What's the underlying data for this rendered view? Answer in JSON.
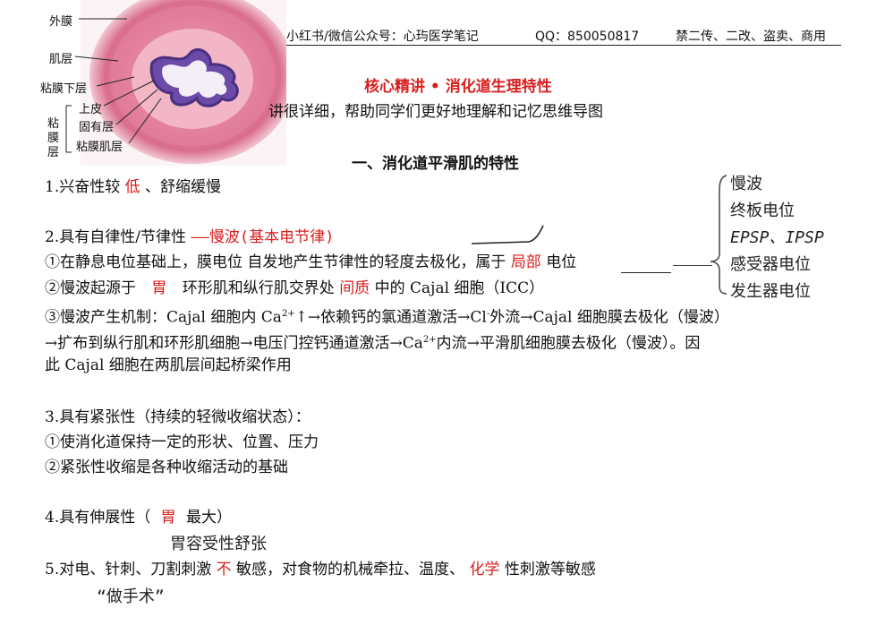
{
  "figure": {
    "labels": {
      "serosa": "外膜",
      "muscularis": "肌层",
      "submucosa": "粘膜下层",
      "epithelium": "上皮",
      "lamina_propria": "固有层",
      "muscularis_mucosae": "粘膜肌层",
      "mucosa_chars": [
        "粘",
        "膜",
        "层"
      ]
    }
  },
  "header": {
    "source": "小红书/微信公众号：心玙医学笔记",
    "qq": "QQ：850050817",
    "notice": "禁二传、二改、盗卖、商用"
  },
  "title": "核心精讲 • 消化道生理特性",
  "subtitle": "讲很详细，帮助同学们更好地理解和记忆思维导图",
  "section_heading": "一、消化道平滑肌的特性",
  "points": {
    "p1": {
      "prefix": "1.兴奋性较 ",
      "blank": "低",
      "suffix": " 、舒缩缓慢"
    },
    "p2": {
      "prefix": "2.具有自律性/节律性 ",
      "handwritten": "——慢波(基本电节律)",
      "l1_prefix": "①在静息电位基础上，膜电位 自发地产生节律性的轻度去极化，属于 ",
      "l1_blank": "局部",
      "l1_suffix": " 电位",
      "l2_prefix": "②慢波起源于 ",
      "l2_blank1": "胃",
      "l2_mid": " 环形肌和纵行肌交界处 ",
      "l2_blank2": "间质",
      "l2_suffix": " 中的 Cajal 细胞（ICC）",
      "l3_a": "③慢波产生机制：Cajal 细胞内 Ca",
      "l3_sup1": "2+",
      "l3_b": "↑→依赖钙的氯通道激活→Cl",
      "l3_sup2": "-",
      "l3_c": "外流→Cajal 细胞膜去极化（慢波）",
      "l4_a": "→扩布到纵行肌和环形肌细胞→电压门控钙通道激活→Ca",
      "l4_sup": "2+",
      "l4_b": "内流→平滑肌细胞膜去极化（慢波）。因",
      "l5": "此 Cajal 细胞在两肌层间起桥梁作用"
    },
    "p3": {
      "title": "3.具有紧张性（持续的轻微收缩状态）：",
      "l1": "①使消化道保持一定的形状、位置、压力",
      "l2": "②紧张性收缩是各种收缩活动的基础"
    },
    "p4": {
      "prefix": "4.具有伸展性（ ",
      "blank": "胃",
      "suffix": " 最大）",
      "note": "胃容受性舒张"
    },
    "p5": {
      "prefix": "5.对电、针刺、刀割刺激 ",
      "blank1": "不",
      "mid": " 敏感，对食物的机械牵拉、温度、 ",
      "blank2": "化学",
      "suffix": " 性刺激等敏感",
      "note": "“做手术”"
    }
  },
  "side_note": {
    "items": [
      "慢波",
      "终板电位",
      "EPSP、IPSP",
      "感受器电位",
      "发生器电位"
    ]
  },
  "colors": {
    "red": "#d81e1e",
    "tissue": "#e48aa4"
  }
}
